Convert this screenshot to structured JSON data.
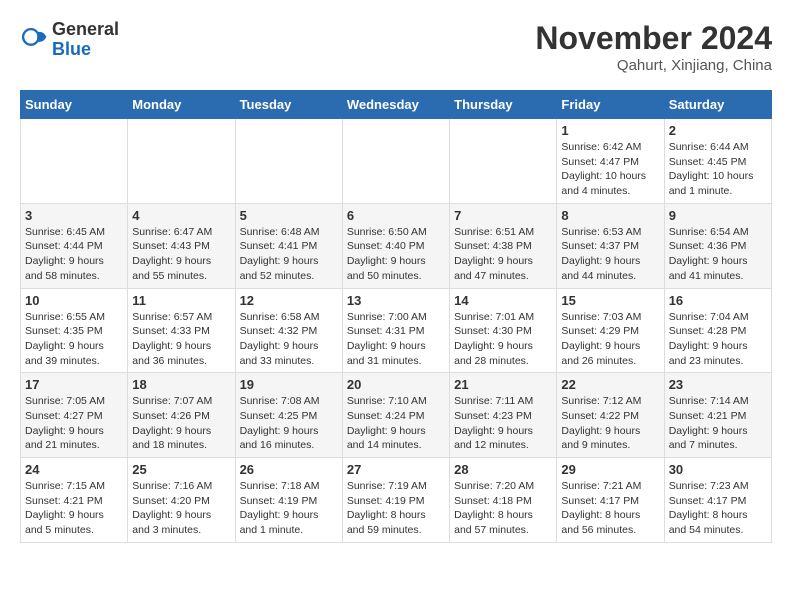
{
  "logo": {
    "general": "General",
    "blue": "Blue"
  },
  "header": {
    "month": "November 2024",
    "location": "Qahurt, Xinjiang, China"
  },
  "weekdays": [
    "Sunday",
    "Monday",
    "Tuesday",
    "Wednesday",
    "Thursday",
    "Friday",
    "Saturday"
  ],
  "weeks": [
    [
      {
        "day": "",
        "info": ""
      },
      {
        "day": "",
        "info": ""
      },
      {
        "day": "",
        "info": ""
      },
      {
        "day": "",
        "info": ""
      },
      {
        "day": "",
        "info": ""
      },
      {
        "day": "1",
        "info": "Sunrise: 6:42 AM\nSunset: 4:47 PM\nDaylight: 10 hours\nand 4 minutes."
      },
      {
        "day": "2",
        "info": "Sunrise: 6:44 AM\nSunset: 4:45 PM\nDaylight: 10 hours\nand 1 minute."
      }
    ],
    [
      {
        "day": "3",
        "info": "Sunrise: 6:45 AM\nSunset: 4:44 PM\nDaylight: 9 hours\nand 58 minutes."
      },
      {
        "day": "4",
        "info": "Sunrise: 6:47 AM\nSunset: 4:43 PM\nDaylight: 9 hours\nand 55 minutes."
      },
      {
        "day": "5",
        "info": "Sunrise: 6:48 AM\nSunset: 4:41 PM\nDaylight: 9 hours\nand 52 minutes."
      },
      {
        "day": "6",
        "info": "Sunrise: 6:50 AM\nSunset: 4:40 PM\nDaylight: 9 hours\nand 50 minutes."
      },
      {
        "day": "7",
        "info": "Sunrise: 6:51 AM\nSunset: 4:38 PM\nDaylight: 9 hours\nand 47 minutes."
      },
      {
        "day": "8",
        "info": "Sunrise: 6:53 AM\nSunset: 4:37 PM\nDaylight: 9 hours\nand 44 minutes."
      },
      {
        "day": "9",
        "info": "Sunrise: 6:54 AM\nSunset: 4:36 PM\nDaylight: 9 hours\nand 41 minutes."
      }
    ],
    [
      {
        "day": "10",
        "info": "Sunrise: 6:55 AM\nSunset: 4:35 PM\nDaylight: 9 hours\nand 39 minutes."
      },
      {
        "day": "11",
        "info": "Sunrise: 6:57 AM\nSunset: 4:33 PM\nDaylight: 9 hours\nand 36 minutes."
      },
      {
        "day": "12",
        "info": "Sunrise: 6:58 AM\nSunset: 4:32 PM\nDaylight: 9 hours\nand 33 minutes."
      },
      {
        "day": "13",
        "info": "Sunrise: 7:00 AM\nSunset: 4:31 PM\nDaylight: 9 hours\nand 31 minutes."
      },
      {
        "day": "14",
        "info": "Sunrise: 7:01 AM\nSunset: 4:30 PM\nDaylight: 9 hours\nand 28 minutes."
      },
      {
        "day": "15",
        "info": "Sunrise: 7:03 AM\nSunset: 4:29 PM\nDaylight: 9 hours\nand 26 minutes."
      },
      {
        "day": "16",
        "info": "Sunrise: 7:04 AM\nSunset: 4:28 PM\nDaylight: 9 hours\nand 23 minutes."
      }
    ],
    [
      {
        "day": "17",
        "info": "Sunrise: 7:05 AM\nSunset: 4:27 PM\nDaylight: 9 hours\nand 21 minutes."
      },
      {
        "day": "18",
        "info": "Sunrise: 7:07 AM\nSunset: 4:26 PM\nDaylight: 9 hours\nand 18 minutes."
      },
      {
        "day": "19",
        "info": "Sunrise: 7:08 AM\nSunset: 4:25 PM\nDaylight: 9 hours\nand 16 minutes."
      },
      {
        "day": "20",
        "info": "Sunrise: 7:10 AM\nSunset: 4:24 PM\nDaylight: 9 hours\nand 14 minutes."
      },
      {
        "day": "21",
        "info": "Sunrise: 7:11 AM\nSunset: 4:23 PM\nDaylight: 9 hours\nand 12 minutes."
      },
      {
        "day": "22",
        "info": "Sunrise: 7:12 AM\nSunset: 4:22 PM\nDaylight: 9 hours\nand 9 minutes."
      },
      {
        "day": "23",
        "info": "Sunrise: 7:14 AM\nSunset: 4:21 PM\nDaylight: 9 hours\nand 7 minutes."
      }
    ],
    [
      {
        "day": "24",
        "info": "Sunrise: 7:15 AM\nSunset: 4:21 PM\nDaylight: 9 hours\nand 5 minutes."
      },
      {
        "day": "25",
        "info": "Sunrise: 7:16 AM\nSunset: 4:20 PM\nDaylight: 9 hours\nand 3 minutes."
      },
      {
        "day": "26",
        "info": "Sunrise: 7:18 AM\nSunset: 4:19 PM\nDaylight: 9 hours\nand 1 minute."
      },
      {
        "day": "27",
        "info": "Sunrise: 7:19 AM\nSunset: 4:19 PM\nDaylight: 8 hours\nand 59 minutes."
      },
      {
        "day": "28",
        "info": "Sunrise: 7:20 AM\nSunset: 4:18 PM\nDaylight: 8 hours\nand 57 minutes."
      },
      {
        "day": "29",
        "info": "Sunrise: 7:21 AM\nSunset: 4:17 PM\nDaylight: 8 hours\nand 56 minutes."
      },
      {
        "day": "30",
        "info": "Sunrise: 7:23 AM\nSunset: 4:17 PM\nDaylight: 8 hours\nand 54 minutes."
      }
    ]
  ]
}
